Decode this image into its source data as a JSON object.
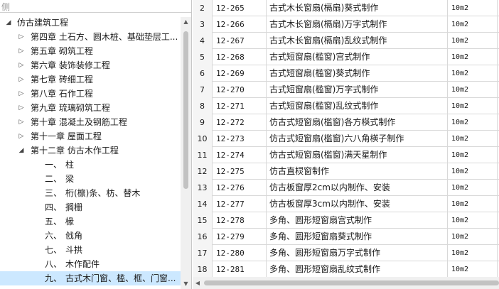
{
  "search": {
    "text": "侧"
  },
  "tree": {
    "root": {
      "label": "仿古建筑工程",
      "expanded": true
    },
    "chapters": [
      {
        "label": "第四章 土石方、圆木桩、基础垫层工...",
        "expanded": false
      },
      {
        "label": "第五章 砌筑工程",
        "expanded": false
      },
      {
        "label": "第六章 装饰装修工程",
        "expanded": false
      },
      {
        "label": "第七章 砖细工程",
        "expanded": false
      },
      {
        "label": "第八章 石作工程",
        "expanded": false
      },
      {
        "label": "第九章 琉璃砌筑工程",
        "expanded": false
      },
      {
        "label": "第十章 混凝土及钢筋工程",
        "expanded": false
      },
      {
        "label": "第十一章 屋面工程",
        "expanded": false
      },
      {
        "label": "第十二章 仿古木作工程",
        "expanded": true
      }
    ],
    "leaves": [
      {
        "num": "一、",
        "label": "柱"
      },
      {
        "num": "二、",
        "label": "梁"
      },
      {
        "num": "三、",
        "label": "桁(檩)条、枋、替木"
      },
      {
        "num": "四、",
        "label": "搁栅"
      },
      {
        "num": "五、",
        "label": "椽"
      },
      {
        "num": "六、",
        "label": "戗角"
      },
      {
        "num": "七、",
        "label": "斗拱"
      },
      {
        "num": "八、",
        "label": "木作配件"
      },
      {
        "num": "九、",
        "label": "古式木门窗、槛、框、门窗...",
        "selected": true
      }
    ]
  },
  "grid": {
    "rows": [
      {
        "n": "2",
        "code": "12-265",
        "name": "古式木长窗扇(槅扇)葵式制作",
        "unit": "10m2"
      },
      {
        "n": "3",
        "code": "12-266",
        "name": "古式木长窗扇(槅扇)万字式制作",
        "unit": "10m2"
      },
      {
        "n": "4",
        "code": "12-267",
        "name": "古式木长窗扇(槅扇)乱纹式制作",
        "unit": "10m2"
      },
      {
        "n": "5",
        "code": "12-268",
        "name": "古式短窗扇(槛窗)宫式制作",
        "unit": "10m2"
      },
      {
        "n": "6",
        "code": "12-269",
        "name": "古式短窗扇(槛窗)葵式制作",
        "unit": "10m2"
      },
      {
        "n": "7",
        "code": "12-270",
        "name": "古式短窗扇(槛窗)万字式制作",
        "unit": "10m2"
      },
      {
        "n": "8",
        "code": "12-271",
        "name": "古式短窗扇(槛窗)乱纹式制作",
        "unit": "10m2"
      },
      {
        "n": "9",
        "code": "12-272",
        "name": "仿古式短窗扇(槛窗)各方楧式制作",
        "unit": "10m2"
      },
      {
        "n": "10",
        "code": "12-273",
        "name": "仿古式短窗扇(槛窗)六八角楧子制作",
        "unit": "10m2"
      },
      {
        "n": "11",
        "code": "12-274",
        "name": "仿古式短窗扇(槛窗)满天星制作",
        "unit": "10m2"
      },
      {
        "n": "12",
        "code": "12-275",
        "name": "仿古直棂窗制作",
        "unit": "10m2"
      },
      {
        "n": "13",
        "code": "12-276",
        "name": "仿古板窗厚2cm以内制作、安装",
        "unit": "10m2"
      },
      {
        "n": "14",
        "code": "12-277",
        "name": "仿古板窗厚3cm以内制作、安装",
        "unit": "10m2"
      },
      {
        "n": "15",
        "code": "12-278",
        "name": "多角、圆形短窗扇宫式制作",
        "unit": "10m2"
      },
      {
        "n": "16",
        "code": "12-279",
        "name": "多角、圆形短窗扇葵式制作",
        "unit": "10m2"
      },
      {
        "n": "17",
        "code": "12-280",
        "name": "多角、圆形短窗扇万字式制作",
        "unit": "10m2"
      },
      {
        "n": "18",
        "code": "12-281",
        "name": "多角、圆形短窗扇乱纹式制作",
        "unit": "10m2"
      }
    ]
  },
  "colors": {
    "selected_bg": "#cce8ff",
    "grid_line": "#d8d8d8",
    "scrollbar_track": "#f0f0f0",
    "scrollbar_thumb": "#c2c2c2"
  },
  "icons": {
    "collapsed": "chevron-right-icon",
    "expanded": "chevron-down-icon"
  }
}
